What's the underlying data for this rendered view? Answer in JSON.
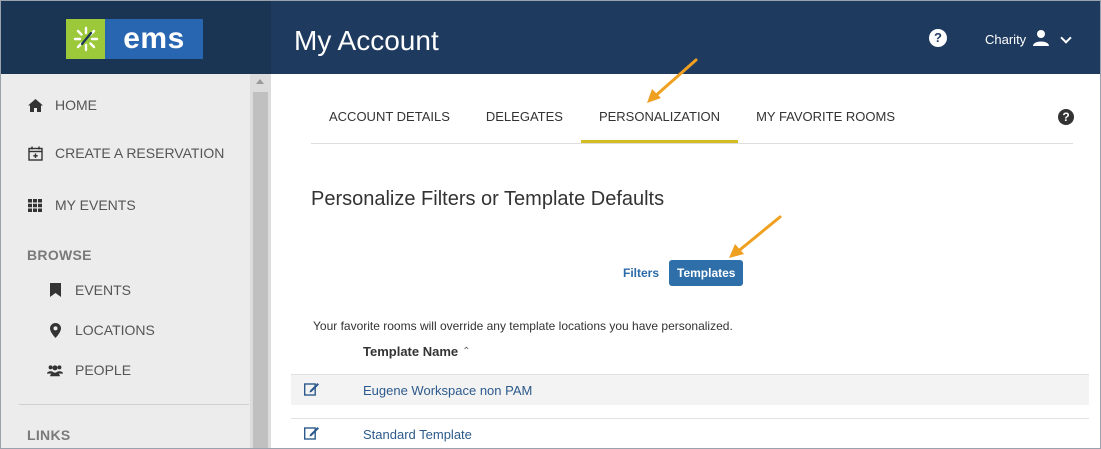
{
  "brand": {
    "logo_text": "ems",
    "logo_mark_color": "#9cc93a",
    "logo_text_color": "#2866b1",
    "topbar_color": "#1f3a5f"
  },
  "header": {
    "title": "My Account",
    "help_icon": "question-circle-icon",
    "user_name": "Charity",
    "user_icon": "user-icon",
    "dropdown_icon": "chevron-down-icon"
  },
  "sidebar": {
    "items": [
      {
        "label": "HOME",
        "icon": "home-icon"
      },
      {
        "label": "CREATE A RESERVATION",
        "icon": "calendar-plus-icon"
      },
      {
        "label": "MY EVENTS",
        "icon": "grid-icon"
      }
    ],
    "browse_label": "BROWSE",
    "browse_items": [
      {
        "label": "EVENTS",
        "icon": "bookmark-icon"
      },
      {
        "label": "LOCATIONS",
        "icon": "map-marker-icon"
      },
      {
        "label": "PEOPLE",
        "icon": "users-icon"
      }
    ],
    "links_label": "LINKS"
  },
  "main": {
    "tabs": [
      {
        "label": "ACCOUNT DETAILS",
        "active": false
      },
      {
        "label": "DELEGATES",
        "active": false
      },
      {
        "label": "PERSONALIZATION",
        "active": true
      },
      {
        "label": "MY FAVORITE ROOMS",
        "active": false
      }
    ],
    "active_tab_color": "#d4bd21",
    "section_title": "Personalize Filters or Template Defaults",
    "toggle": {
      "filters_label": "Filters",
      "templates_label": "Templates",
      "selected": "Templates"
    },
    "notice": "Your favorite rooms will override any template locations you have personalized.",
    "table": {
      "column_header": "Template Name",
      "sort_icon": "caret-up-icon",
      "rows": [
        {
          "name": "Eugene Workspace non PAM",
          "icon": "edit-icon"
        },
        {
          "name": "Standard Template",
          "icon": "edit-icon"
        }
      ]
    }
  },
  "annotation_arrow_color": "#f0a020"
}
